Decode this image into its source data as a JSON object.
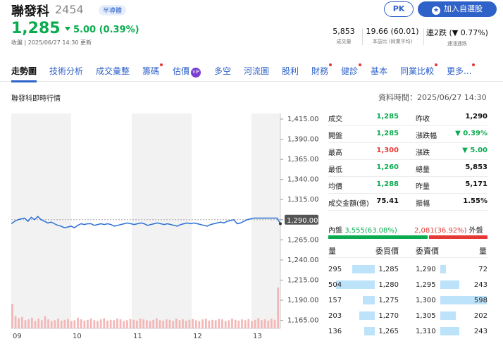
{
  "header": {
    "name": "聯發科",
    "code": "2454",
    "badge": "半導體",
    "price": "1,285",
    "change": "5.00 (0.39%)",
    "time": "收盤 | 2025/06/27 14:30 更新",
    "pk_label": "PK",
    "add_label": "加入自選股",
    "stats": [
      {
        "value": "5,853",
        "label": "成交量"
      },
      {
        "value": "19.66 (60.01)",
        "label": "本益比 (同業平均)"
      },
      {
        "value": "連2跌 (▼ 0.77%)",
        "label": "連漲連跌"
      }
    ]
  },
  "tabs": [
    {
      "label": "走勢圖",
      "dot": false,
      "vip": false
    },
    {
      "label": "技術分析",
      "dot": false,
      "vip": false
    },
    {
      "label": "成交彙整",
      "dot": false,
      "vip": false
    },
    {
      "label": "籌碼",
      "dot": true,
      "vip": false
    },
    {
      "label": "估價",
      "dot": false,
      "vip": true
    },
    {
      "label": "多空",
      "dot": false,
      "vip": false
    },
    {
      "label": "河流圖",
      "dot": false,
      "vip": false
    },
    {
      "label": "股利",
      "dot": false,
      "vip": false
    },
    {
      "label": "財務",
      "dot": true,
      "vip": false
    },
    {
      "label": "健診",
      "dot": true,
      "vip": false
    },
    {
      "label": "基本",
      "dot": false,
      "vip": false
    },
    {
      "label": "同業比較",
      "dot": true,
      "vip": false
    },
    {
      "label": "更多...",
      "dot": true,
      "vip": false
    }
  ],
  "section": {
    "title": "聯發科即時行情",
    "time": "資料時間：2025/06/27 14:30"
  },
  "chart_data": {
    "type": "line",
    "x_ticks": [
      "09",
      "10",
      "11",
      "12",
      "13"
    ],
    "y_ticks": [
      1415,
      1390,
      1365,
      1340,
      1315,
      1290,
      1265,
      1240,
      1215,
      1190,
      1165
    ],
    "y_tick_labels": [
      "1,415.00",
      "1,390.00",
      "1,365.00",
      "1,340.00",
      "1,315.00",
      "1,290.00",
      "1,265.00",
      "1,240.00",
      "1,215.00",
      "1,190.00",
      "1,165.00"
    ],
    "ylim": [
      1155,
      1415
    ],
    "prev_close": 1290,
    "prev_close_label": "1,290.00",
    "close": 1285,
    "price_series": [
      1285,
      1288,
      1290,
      1291,
      1292,
      1288,
      1293,
      1290,
      1294,
      1290,
      1288,
      1286,
      1287,
      1285,
      1283,
      1282,
      1280,
      1281,
      1282,
      1280,
      1283,
      1285,
      1284,
      1285,
      1285,
      1283,
      1284,
      1285,
      1284,
      1285,
      1284,
      1282,
      1283,
      1284,
      1285,
      1286,
      1285,
      1284,
      1285,
      1286,
      1285,
      1283,
      1284,
      1285,
      1286,
      1285,
      1284,
      1285,
      1284,
      1283,
      1282,
      1284,
      1285,
      1286,
      1285,
      1286,
      1285,
      1284,
      1283,
      1282,
      1284,
      1285,
      1286,
      1287,
      1286,
      1288,
      1289,
      1290,
      1285,
      1286,
      1288,
      1290,
      1291,
      1292,
      1292,
      1292,
      1292,
      1292,
      1292,
      1292,
      1292,
      1285
    ],
    "volume_max": 100,
    "volume_series": [
      60,
      30,
      25,
      28,
      20,
      22,
      26,
      18,
      24,
      20,
      30,
      22,
      18,
      20,
      24,
      19,
      21,
      23,
      18,
      20,
      26,
      22,
      19,
      21,
      24,
      20,
      18,
      22,
      25,
      19,
      21,
      20,
      24,
      22,
      18,
      20,
      23,
      21,
      19,
      24,
      22,
      20,
      18,
      21,
      25,
      20,
      19,
      22,
      21,
      18,
      24,
      20,
      22,
      19,
      21,
      23,
      20,
      18,
      22,
      24,
      19,
      21,
      20,
      23,
      22,
      18,
      20,
      24,
      21,
      19,
      22,
      20,
      23,
      18,
      21,
      25,
      20,
      22,
      19,
      24,
      21,
      100
    ]
  },
  "quote": {
    "left": [
      {
        "label": "成交",
        "value": "1,285",
        "color": "green"
      },
      {
        "label": "開盤",
        "value": "1,285",
        "color": "green"
      },
      {
        "label": "最高",
        "value": "1,300",
        "color": "red"
      },
      {
        "label": "最低",
        "value": "1,260",
        "color": "green"
      },
      {
        "label": "均價",
        "value": "1,288",
        "color": "green"
      },
      {
        "label": "成交金額(億)",
        "value": "75.41",
        "color": "black"
      }
    ],
    "right": [
      {
        "label": "昨收",
        "value": "1,290",
        "color": "black"
      },
      {
        "label": "漲跌幅",
        "value": "▼ 0.39%",
        "color": "green"
      },
      {
        "label": "漲跌",
        "value": "▼ 5.00",
        "color": "green"
      },
      {
        "label": "總量",
        "value": "5,853",
        "color": "black"
      },
      {
        "label": "昨量",
        "value": "5,171",
        "color": "black"
      },
      {
        "label": "振幅",
        "value": "1.55%",
        "color": "black"
      }
    ]
  },
  "inout": {
    "inner_label": "內盤",
    "inner_value": "3,555",
    "inner_pct": "(63.08%)",
    "inner_fraction": 0.6308,
    "outer_value": "2,081",
    "outer_pct": "(36.92%)",
    "outer_label": "外盤"
  },
  "orderbook": {
    "headers": [
      "量",
      "委買價",
      "委賣價",
      "量"
    ],
    "max_qty": 600,
    "rows": [
      {
        "bid_qty": "295",
        "bid_price": "1,285",
        "ask_price": "1,290",
        "ask_qty": "72"
      },
      {
        "bid_qty": "504",
        "bid_price": "1,280",
        "ask_price": "1,295",
        "ask_qty": "243"
      },
      {
        "bid_qty": "157",
        "bid_price": "1,275",
        "ask_price": "1,300",
        "ask_qty": "598"
      },
      {
        "bid_qty": "203",
        "bid_price": "1,270",
        "ask_price": "1,305",
        "ask_qty": "202"
      },
      {
        "bid_qty": "136",
        "bid_price": "1,265",
        "ask_price": "1,310",
        "ask_qty": "243"
      }
    ]
  }
}
